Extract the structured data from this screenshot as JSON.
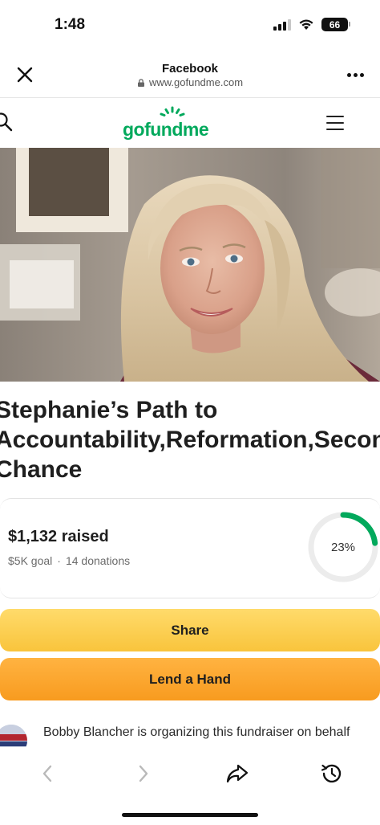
{
  "status_bar": {
    "time": "1:48",
    "battery": "66",
    "icons": [
      "signal-icon",
      "wifi-icon",
      "battery-icon"
    ]
  },
  "browser": {
    "title": "Facebook",
    "url": "www.gofundme.com",
    "icons": [
      "close-icon",
      "lock-icon",
      "more-icon"
    ]
  },
  "site_nav": {
    "logo": "gofundme",
    "icons": [
      "search-icon",
      "menu-icon"
    ]
  },
  "campaign": {
    "title_lines": [
      "Stephanie’s Path to",
      "Accountability,Reformation,Second",
      "Chance"
    ],
    "raised": "$1,132 raised",
    "goal": "$5K goal",
    "separator": "·",
    "donations": "14 donations",
    "percent_label": "23%",
    "percent_value": 0.23
  },
  "actions": {
    "share_label": "Share",
    "donate_label": "Lend a Hand"
  },
  "organizer": {
    "text": "Bobby Blancher is organizing this fundraiser on behalf"
  },
  "toolbar": {
    "icons": [
      "back-icon",
      "forward-icon",
      "share-icon",
      "history-icon"
    ]
  },
  "colors": {
    "brand_green": "#02a95c",
    "share_button": "#f9c43c",
    "donate_button": "#f89b1f",
    "progress_track": "#ececec"
  }
}
